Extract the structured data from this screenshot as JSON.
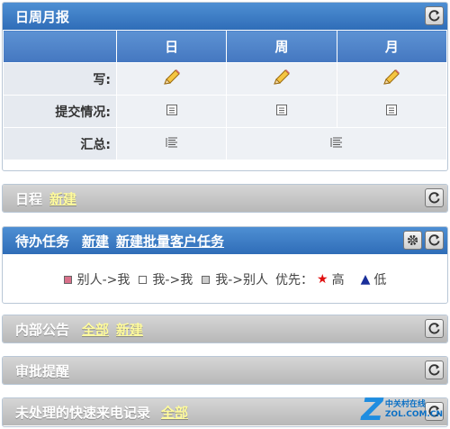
{
  "report": {
    "title": "日周月报",
    "columns": [
      "日",
      "周",
      "月"
    ],
    "rows": {
      "write": "写:",
      "submit": "提交情况:",
      "summary": "汇总:"
    }
  },
  "schedule": {
    "title": "日程",
    "link_new": "新建"
  },
  "todo": {
    "title": "待办任务",
    "link_new": "新建",
    "link_batch": "新建批量客户任务",
    "legend": {
      "others_to_me": "别人->我",
      "me_to_me": "我->我",
      "me_to_others": "我->别人",
      "priority": "优先：",
      "high": "高",
      "low": "低"
    },
    "colors": {
      "others_to_me": "#d9708a",
      "me_to_me": "#ffffff",
      "me_to_others": "#cccccc"
    }
  },
  "notice": {
    "title": "内部公告",
    "link_all": "全部",
    "link_new": "新建"
  },
  "approval": {
    "title": "审批提醒"
  },
  "calls": {
    "title": "未处理的快速来电记录",
    "link_all": "全部"
  },
  "watermark": {
    "mark": "Z",
    "line1": "中关村在线",
    "line2": "ZOL.COM.CN"
  }
}
